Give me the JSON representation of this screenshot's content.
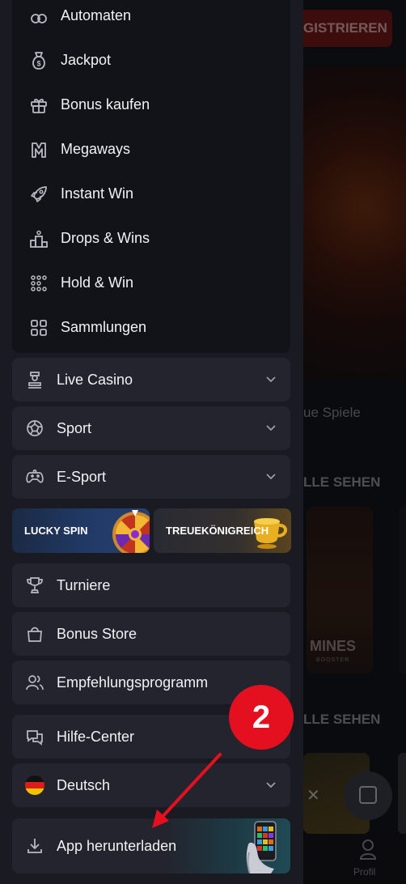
{
  "background": {
    "register_label": "GISTRIEREN",
    "new_games_label": "ue Spiele",
    "see_all_1": "LLE SEHEN",
    "see_all_2": "LLE SEHEN",
    "mines_title": "MINES",
    "mines_sub": "BOOSTER",
    "profile_label": "Profil"
  },
  "submenu": {
    "items": [
      {
        "label": "Automaten",
        "icon": "slot-machine-icon"
      },
      {
        "label": "Jackpot",
        "icon": "money-bag-icon"
      },
      {
        "label": "Bonus kaufen",
        "icon": "gift-icon"
      },
      {
        "label": "Megaways",
        "icon": "megaways-icon"
      },
      {
        "label": "Instant Win",
        "icon": "rocket-icon"
      },
      {
        "label": "Drops & Wins",
        "icon": "podium-icon"
      },
      {
        "label": "Hold & Win",
        "icon": "grid-dots-icon"
      },
      {
        "label": "Sammlungen",
        "icon": "collection-grid-icon"
      }
    ]
  },
  "menu": {
    "live_casino": "Live Casino",
    "sport": "Sport",
    "esport": "E-Sport",
    "lucky_spin": "LUCKY SPIN",
    "treue": "TREUEKÖNIGREICH",
    "turniere": "Turniere",
    "bonus_store": "Bonus Store",
    "empfehlung": "Empfehlungsprogramm",
    "hilfe": "Hilfe-Center",
    "language": "Deutsch",
    "app_download": "App herunterladen"
  },
  "annotation": {
    "step_number": "2",
    "badge_color": "#e4101f"
  }
}
